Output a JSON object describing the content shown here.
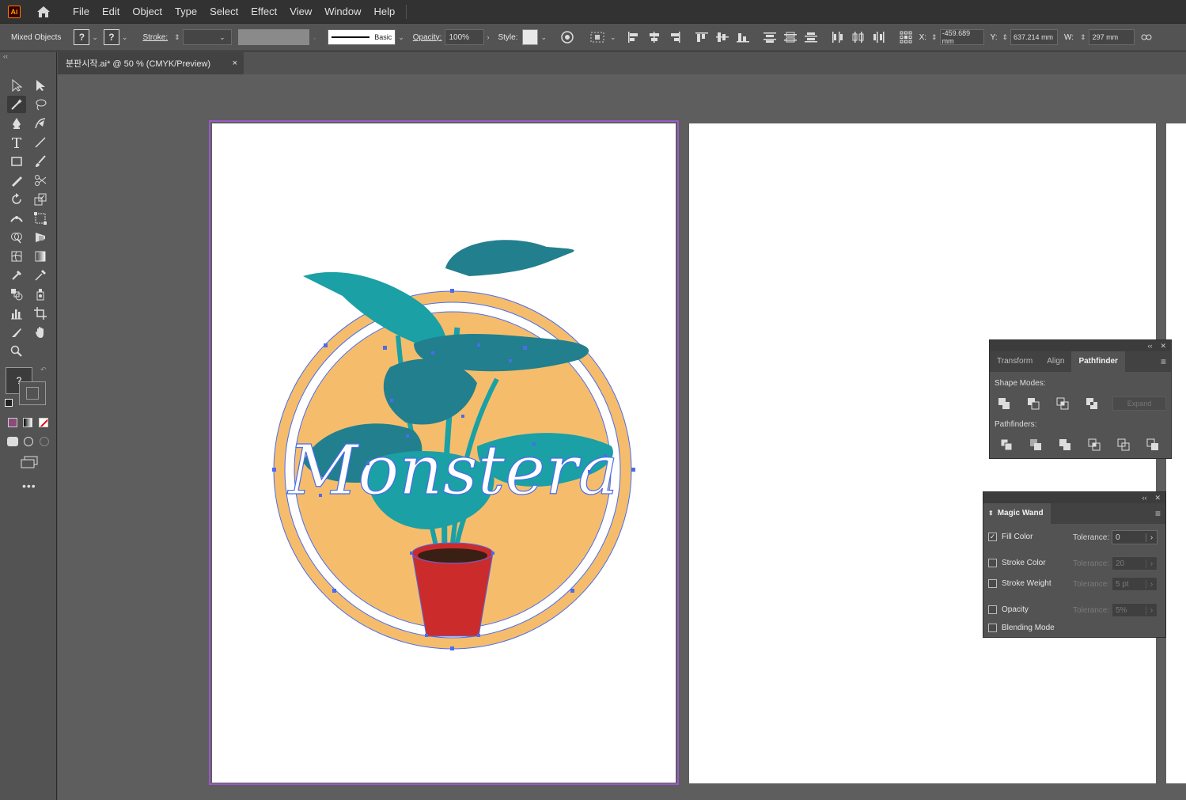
{
  "app": {
    "logo_text": "Ai"
  },
  "menu": [
    "File",
    "Edit",
    "Object",
    "Type",
    "Select",
    "Effect",
    "View",
    "Window",
    "Help"
  ],
  "control": {
    "selection_label": "Mixed Objects",
    "stroke_label": "Stroke:",
    "brush_label": "Basic",
    "opacity_label": "Opacity:",
    "opacity_value": "100%",
    "style_label": "Style:",
    "x_label": "X:",
    "x_value": "-459.689 mm",
    "y_label": "Y:",
    "y_value": "637.214 mm",
    "w_label": "W:",
    "w_value": "297 mm",
    "question": "?"
  },
  "document": {
    "tab_title": "분판시작.ai* @ 50 % (CMYK/Preview)",
    "close": "×"
  },
  "artwork": {
    "text": "Monstera"
  },
  "pathfinder_panel": {
    "tabs": [
      "Transform",
      "Align",
      "Pathfinder"
    ],
    "selected_tab": "Pathfinder",
    "shape_modes_label": "Shape Modes:",
    "expand_label": "Expand",
    "pathfinders_label": "Pathfinders:"
  },
  "magic_wand_panel": {
    "title": "Magic Wand",
    "rows": [
      {
        "label": "Fill Color",
        "checked": true,
        "tolerance_label": "Tolerance:",
        "tolerance": "0",
        "enabled": true
      },
      {
        "label": "Stroke Color",
        "checked": false,
        "tolerance_label": "Tolerance:",
        "tolerance": "20",
        "enabled": false
      },
      {
        "label": "Stroke Weight",
        "checked": false,
        "tolerance_label": "Tolerance:",
        "tolerance": "5 pt",
        "enabled": false
      },
      {
        "label": "Opacity",
        "checked": false,
        "tolerance_label": "Tolerance:",
        "tolerance": "5%",
        "enabled": false
      },
      {
        "label": "Blending Mode",
        "checked": false
      }
    ]
  },
  "colors": {
    "artboard_frame": "#9b59c9",
    "circle_fill": "#f5bd6b",
    "leaf_teal": "#1aa0a5",
    "leaf_dark": "#227f8e",
    "pot_red": "#cc2b2b",
    "selection_blue": "#4a6cf0"
  }
}
